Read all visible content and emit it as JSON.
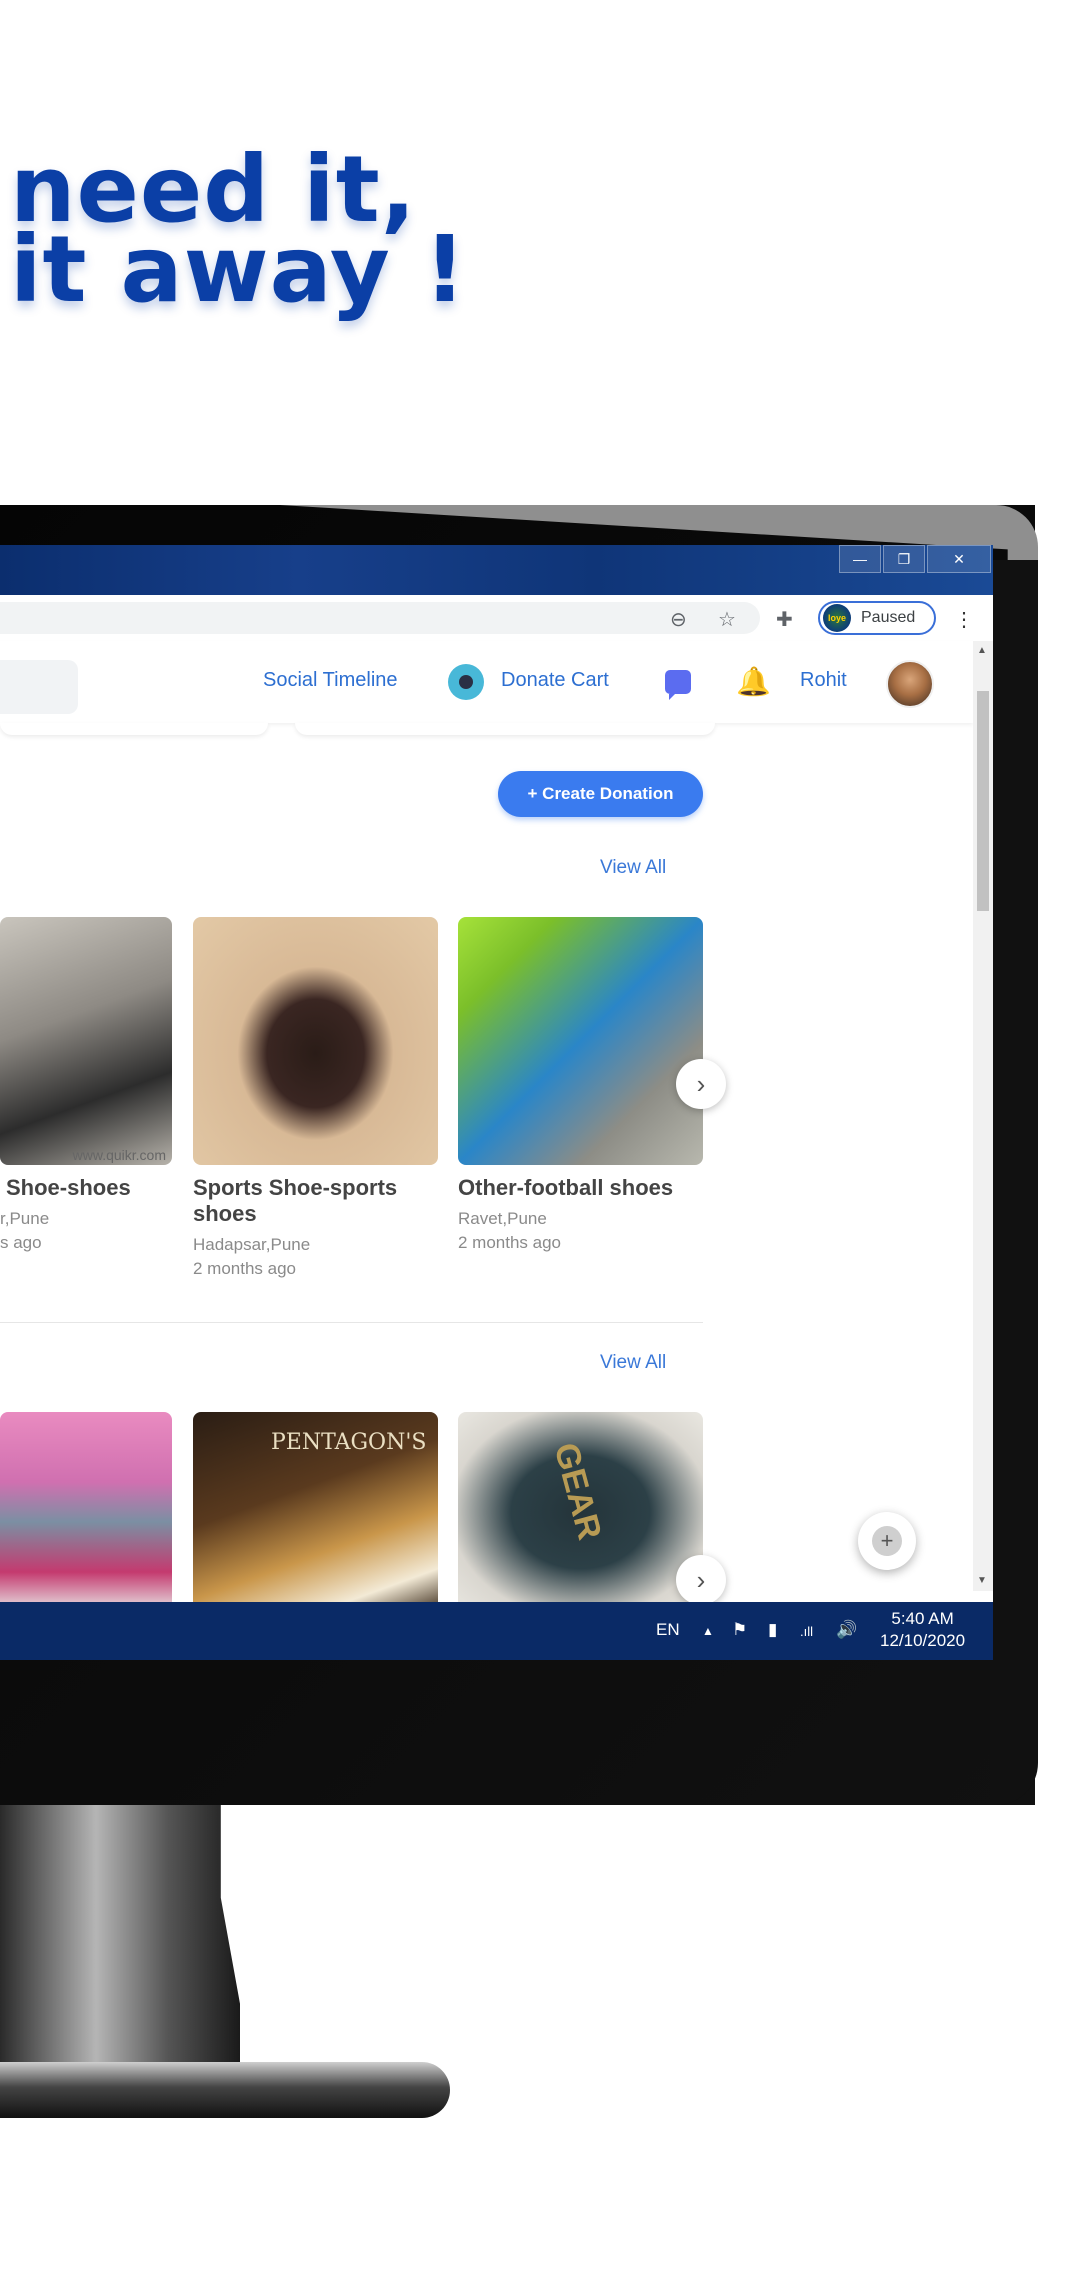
{
  "headline": {
    "line1": "need it,",
    "line2": "it away !"
  },
  "window": {
    "minimize": "—",
    "restore": "❐",
    "close": "✕"
  },
  "browser": {
    "zoom_icon": "zoom-out-icon",
    "star_icon": "star-icon",
    "extensions_icon": "puzzle-icon",
    "profile_badge": "loye",
    "profile_status": "Paused",
    "menu_icon": "⋮"
  },
  "nav": {
    "social_timeline": "Social Timeline",
    "donate_cart": "Donate Cart",
    "user_name": "Rohit"
  },
  "actions": {
    "create_donation": "+ Create Donation"
  },
  "sections": [
    {
      "view_all": "View All",
      "items": [
        {
          "title": "Shoe-shoes",
          "location": "r,Pune",
          "time": "s ago",
          "watermark": "www.quikr.com"
        },
        {
          "title": "Sports Shoe-sports shoes",
          "location": "Hadapsar,Pune",
          "time": "2 months ago"
        },
        {
          "title": "Other-football shoes",
          "location": "Ravet,Pune",
          "time": "2 months ago"
        }
      ]
    },
    {
      "view_all": "View All",
      "items": [
        {
          "title": "",
          "image_label": ""
        },
        {
          "title": "",
          "image_label": "PENTAGON'S"
        },
        {
          "title": "",
          "image_label": "GEAR"
        }
      ]
    }
  ],
  "taskbar": {
    "lang": "EN",
    "up_arrow": "▲",
    "time": "5:40 AM",
    "date": "12/10/2020"
  },
  "fab": {
    "label": "+"
  }
}
